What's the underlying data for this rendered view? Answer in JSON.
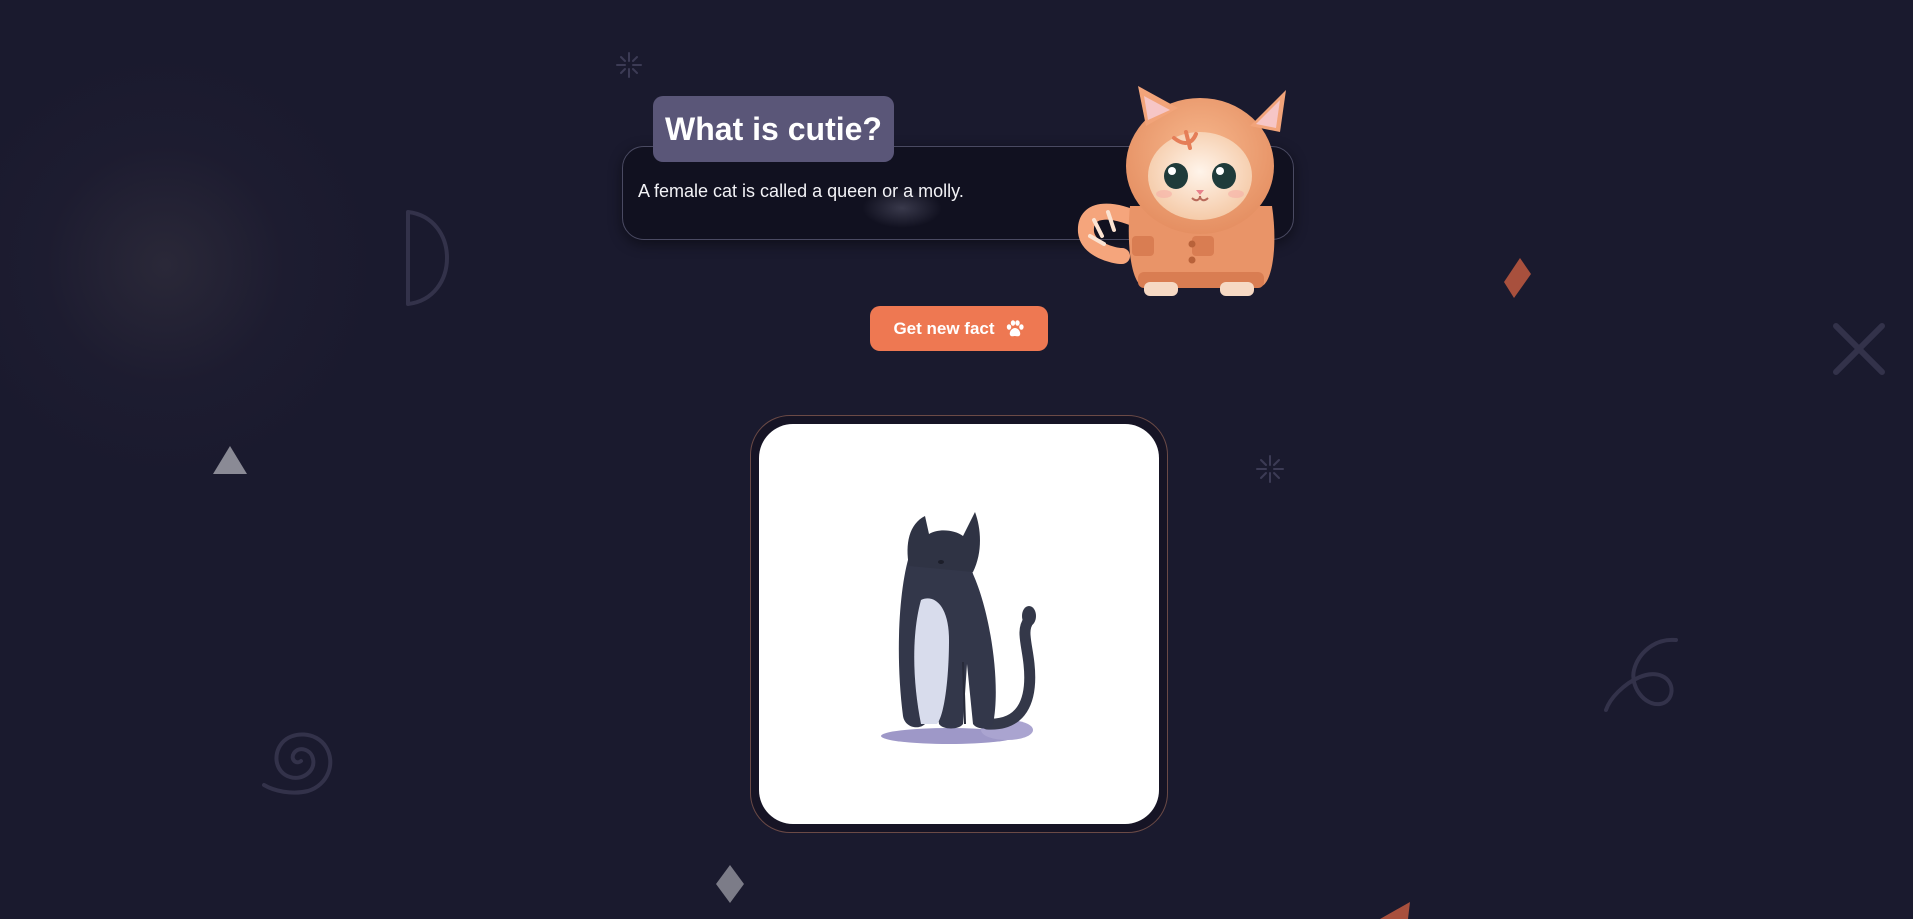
{
  "header": {
    "title": "What is cutie?"
  },
  "fact": {
    "text": "A female cat is called a queen or a molly."
  },
  "actions": {
    "new_fact_label": "Get new fact",
    "new_fact_icon": "paw-icon"
  },
  "images": {
    "mascot": "kitten-in-hoodie",
    "illustration": "sitting-black-cat"
  },
  "colors": {
    "background": "#1a1a2e",
    "accent": "#ee7852",
    "title_badge": "#5a5678",
    "card": "#111120"
  }
}
